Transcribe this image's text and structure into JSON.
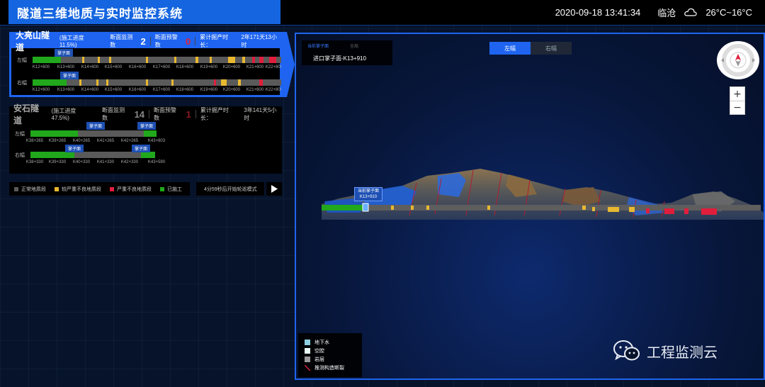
{
  "header": {
    "title": "隧道三维地质与实时监控系统",
    "datetime": "2020-09-18 13:41:34",
    "city": "临沧",
    "weather_icon": "cloud-icon",
    "temperature": "26°C~16°C"
  },
  "tunnels": [
    {
      "name": "大亮山隧道",
      "progress": "(施工进度11.5%)",
      "monitor_label": "断面监测数",
      "monitor_count": "2",
      "warning_label": "断面预警数",
      "warning_count": "0",
      "time_label": "累计掘产时长：",
      "time_value": "2年171天13小时",
      "left": {
        "label": "左幅",
        "face_tag": "掌子面",
        "ticks": [
          "K12+600",
          "K13+600",
          "K14+600",
          "K15+600",
          "K16+600",
          "K17+600",
          "K18+600",
          "K19+600",
          "K20+600",
          "K21+600",
          "K22+800"
        ]
      },
      "right": {
        "label": "右幅",
        "face_tag": "掌子面",
        "ticks": [
          "K12+600",
          "K13+600",
          "K14+600",
          "K15+600",
          "K16+600",
          "K17+600",
          "K18+600",
          "K19+600",
          "K20+600",
          "K21+600",
          "K22+800"
        ]
      }
    },
    {
      "name": "安石隧道",
      "progress": "(施工进度47.5%)",
      "monitor_label": "断面监测数",
      "monitor_count": "14",
      "warning_label": "断面预警数",
      "warning_count": "1",
      "time_label": "累计掘产时长：",
      "time_value": "3年141天5小时",
      "left": {
        "label": "左幅",
        "face_tag_a": "掌子面",
        "face_tag_b": "掌子面",
        "ticks": [
          "K38+265",
          "K39+265",
          "K40+265",
          "K41+265",
          "K42+265",
          "K43+603"
        ]
      },
      "right": {
        "label": "右幅",
        "face_tag_a": "掌子面",
        "face_tag_b": "掌子面",
        "ticks": [
          "K38+330",
          "K39+330",
          "K40+330",
          "K41+330",
          "K42+330",
          "K43+590"
        ]
      }
    }
  ],
  "legend": {
    "items": [
      {
        "label": "正常地质段",
        "color": "#5a5a5a"
      },
      {
        "label": "较严重不良地质段",
        "color": "#e8b830"
      },
      {
        "label": "严重不良地质段",
        "color": "#e01e3c"
      },
      {
        "label": "已施工",
        "color": "#21a81c"
      }
    ],
    "patrol_text": "4分59秒后开始轮巡模式",
    "play_icon": "play-icon"
  },
  "view3d": {
    "tab_current": "当前掌子面",
    "tab_all": "全局",
    "face_value": "进口掌子面-K13+910",
    "side_left": "左幅",
    "side_right": "右幅",
    "face_marker_line1": "当前掌子面",
    "face_marker_line2": "K13+910",
    "zoom_in": "+",
    "zoom_out": "−",
    "legend": [
      {
        "label": "地下水",
        "color": "#8fd0e0"
      },
      {
        "label": "空腔",
        "color": "#e8f8f4"
      },
      {
        "label": "岩层",
        "color": "#9a9a9a"
      },
      {
        "label": "推测构造断裂",
        "color": "#d0283c"
      }
    ]
  },
  "watermark": {
    "text": "工程监测云",
    "icon": "wechat-icon"
  }
}
